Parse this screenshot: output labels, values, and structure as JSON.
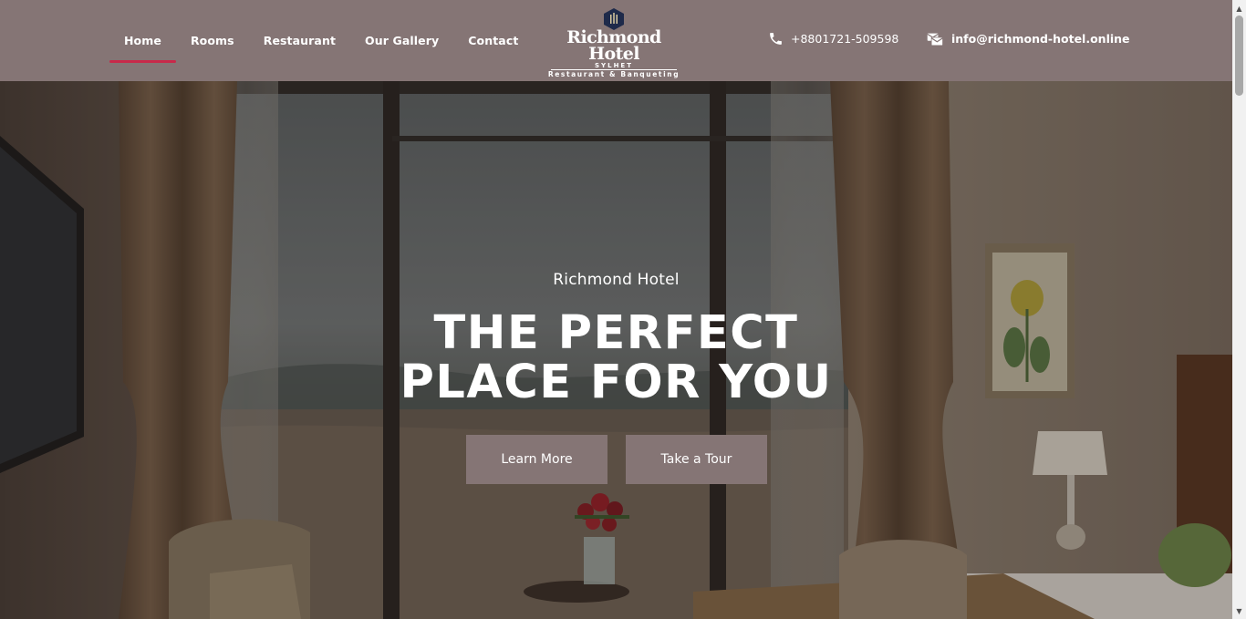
{
  "colors": {
    "header_bg": "#857575",
    "nav_active_underline": "#c8294a",
    "button_bg": "#857575",
    "logo_mark": "#1e2a4a"
  },
  "nav": {
    "items": [
      {
        "label": "Home",
        "active": true
      },
      {
        "label": "Rooms",
        "active": false
      },
      {
        "label": "Restaurant",
        "active": false
      },
      {
        "label": "Our Gallery",
        "active": false
      },
      {
        "label": "Contact",
        "active": false
      }
    ]
  },
  "logo": {
    "name": "Richmond Hotel",
    "city": "SYLHET",
    "tagline": "Restaurant & Banqueting",
    "icon": "hotel-crest-icon"
  },
  "contact": {
    "phone": "+8801721-509598",
    "phone_icon": "phone-icon",
    "email": "info@richmond-hotel.online",
    "email_icon": "mail-icon"
  },
  "hero": {
    "kicker": "Richmond Hotel",
    "title_line1": "THE PERFECT",
    "title_line2": "PLACE FOR YOU",
    "buttons": {
      "learn_more": "Learn More",
      "take_tour": "Take a Tour"
    }
  }
}
